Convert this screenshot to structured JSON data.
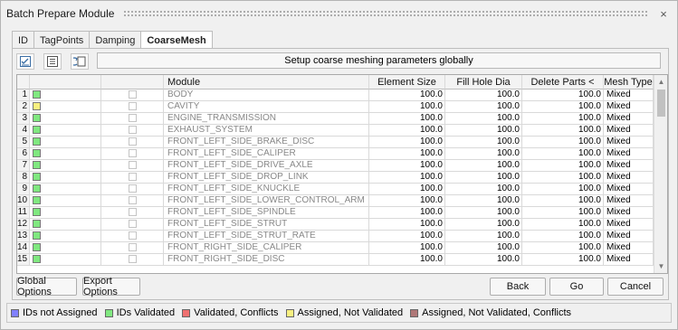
{
  "window": {
    "title": "Batch Prepare Module",
    "close_glyph": "×"
  },
  "tabs": [
    {
      "label": "ID",
      "active": false
    },
    {
      "label": "TagPoints",
      "active": false
    },
    {
      "label": "Damping",
      "active": false
    },
    {
      "label": "CoarseMesh",
      "active": true
    }
  ],
  "toolbar": {
    "buttons": [
      {
        "icon": "checklist-icon"
      },
      {
        "icon": "list-icon"
      },
      {
        "icon": "refresh-list-icon"
      }
    ],
    "setup_label": "Setup coarse meshing parameters globally"
  },
  "table": {
    "columns": [
      "Module",
      "Element Size",
      "Fill Hole Dia",
      "Delete Parts <",
      "Mesh Type"
    ],
    "rows": [
      {
        "num": "1",
        "status": "validated",
        "module": "BODY",
        "element_size": "100.0",
        "fill_hole_dia": "100.0",
        "delete_parts": "100.0",
        "mesh_type": "Mixed"
      },
      {
        "num": "2",
        "status": "assigned_not_validated",
        "module": "CAVITY",
        "element_size": "100.0",
        "fill_hole_dia": "100.0",
        "delete_parts": "100.0",
        "mesh_type": "Mixed"
      },
      {
        "num": "3",
        "status": "validated",
        "module": "ENGINE_TRANSMISSION",
        "element_size": "100.0",
        "fill_hole_dia": "100.0",
        "delete_parts": "100.0",
        "mesh_type": "Mixed"
      },
      {
        "num": "4",
        "status": "validated",
        "module": "EXHAUST_SYSTEM",
        "element_size": "100.0",
        "fill_hole_dia": "100.0",
        "delete_parts": "100.0",
        "mesh_type": "Mixed"
      },
      {
        "num": "5",
        "status": "validated",
        "module": "FRONT_LEFT_SIDE_BRAKE_DISC",
        "element_size": "100.0",
        "fill_hole_dia": "100.0",
        "delete_parts": "100.0",
        "mesh_type": "Mixed"
      },
      {
        "num": "6",
        "status": "validated",
        "module": "FRONT_LEFT_SIDE_CALIPER",
        "element_size": "100.0",
        "fill_hole_dia": "100.0",
        "delete_parts": "100.0",
        "mesh_type": "Mixed"
      },
      {
        "num": "7",
        "status": "validated",
        "module": "FRONT_LEFT_SIDE_DRIVE_AXLE",
        "element_size": "100.0",
        "fill_hole_dia": "100.0",
        "delete_parts": "100.0",
        "mesh_type": "Mixed"
      },
      {
        "num": "8",
        "status": "validated",
        "module": "FRONT_LEFT_SIDE_DROP_LINK",
        "element_size": "100.0",
        "fill_hole_dia": "100.0",
        "delete_parts": "100.0",
        "mesh_type": "Mixed"
      },
      {
        "num": "9",
        "status": "validated",
        "module": "FRONT_LEFT_SIDE_KNUCKLE",
        "element_size": "100.0",
        "fill_hole_dia": "100.0",
        "delete_parts": "100.0",
        "mesh_type": "Mixed"
      },
      {
        "num": "10",
        "status": "validated",
        "module": "FRONT_LEFT_SIDE_LOWER_CONTROL_ARM",
        "element_size": "100.0",
        "fill_hole_dia": "100.0",
        "delete_parts": "100.0",
        "mesh_type": "Mixed"
      },
      {
        "num": "11",
        "status": "validated",
        "module": "FRONT_LEFT_SIDE_SPINDLE",
        "element_size": "100.0",
        "fill_hole_dia": "100.0",
        "delete_parts": "100.0",
        "mesh_type": "Mixed"
      },
      {
        "num": "12",
        "status": "validated",
        "module": "FRONT_LEFT_SIDE_STRUT",
        "element_size": "100.0",
        "fill_hole_dia": "100.0",
        "delete_parts": "100.0",
        "mesh_type": "Mixed"
      },
      {
        "num": "13",
        "status": "validated",
        "module": "FRONT_LEFT_SIDE_STRUT_RATE",
        "element_size": "100.0",
        "fill_hole_dia": "100.0",
        "delete_parts": "100.0",
        "mesh_type": "Mixed"
      },
      {
        "num": "14",
        "status": "validated",
        "module": "FRONT_RIGHT_SIDE_CALIPER",
        "element_size": "100.0",
        "fill_hole_dia": "100.0",
        "delete_parts": "100.0",
        "mesh_type": "Mixed"
      },
      {
        "num": "15",
        "status": "validated",
        "module": "FRONT_RIGHT_SIDE_DISC",
        "element_size": "100.0",
        "fill_hole_dia": "100.0",
        "delete_parts": "100.0",
        "mesh_type": "Mixed"
      }
    ]
  },
  "status_colors": {
    "not_assigned": "#8080ff",
    "validated": "#80e880",
    "validated_conflicts": "#f07070",
    "assigned_not_validated": "#f8f080",
    "assigned_not_validated_conflicts": "#b07878"
  },
  "buttons": {
    "global_options": "Global Options",
    "export_options": "Export Options",
    "back": "Back",
    "go": "Go",
    "cancel": "Cancel"
  },
  "legend": [
    {
      "key": "not_assigned",
      "label": "IDs not Assigned"
    },
    {
      "key": "validated",
      "label": "IDs Validated"
    },
    {
      "key": "validated_conflicts",
      "label": "Validated, Conflicts"
    },
    {
      "key": "assigned_not_validated",
      "label": "Assigned, Not Validated"
    },
    {
      "key": "assigned_not_validated_conflicts",
      "label": "Assigned, Not Validated, Conflicts"
    }
  ]
}
